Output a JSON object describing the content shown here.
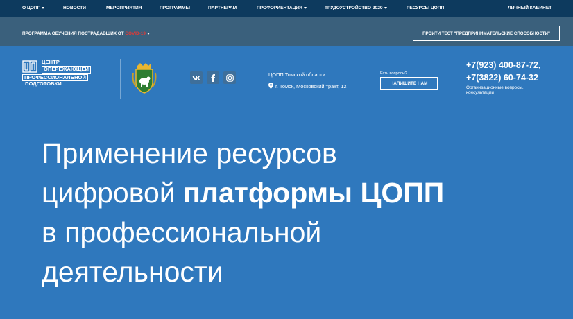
{
  "nav": {
    "items": [
      {
        "label": "О ЦОПП",
        "dropdown": true
      },
      {
        "label": "НОВОСТИ",
        "dropdown": false
      },
      {
        "label": "МЕРОПРИЯТИЯ",
        "dropdown": false
      },
      {
        "label": "ПРОГРАММЫ",
        "dropdown": false
      },
      {
        "label": "ПАРТНЕРАМ",
        "dropdown": false
      },
      {
        "label": "ПРОФОРИЕНТАЦИЯ",
        "dropdown": true
      },
      {
        "label": "ТРУДОУСТРОЙСТВО 2020",
        "dropdown": true
      },
      {
        "label": "РЕСУРСЫ ЦОПП",
        "dropdown": false
      },
      {
        "label": "ЛИЧНЫЙ КАБИНЕТ",
        "dropdown": false
      }
    ]
  },
  "subbar": {
    "program_label": "ПРОГРАММА ОБУЧЕНИЯ ПОСТРАДАВШИХ ОТ",
    "program_highlight": "COVID-19",
    "test_button": "ПРОЙТИ ТЕСТ \"ПРЕДПРИНИМАТЕЛЬСКИЕ СПОСОБНОСТИ\""
  },
  "logo": {
    "lines": [
      "ЦЕНТР",
      "ОПЕРЕЖАЮЩЕЙ",
      "ПРОФЕССИОНАЛЬНОЙ",
      "ПОДГОТОВКИ"
    ]
  },
  "social": {
    "vk": "vk-icon",
    "facebook": "facebook-icon",
    "instagram": "instagram-icon"
  },
  "contact": {
    "org_name": "ЦОПП Томской области",
    "address": "г. Томск, Московский тракт, 12",
    "questions": "Есть вопросы?",
    "write_button": "НАПИШИТЕ НАМ",
    "phone1": "+7(923) 400-87-72,",
    "phone2": "+7(3822) 60-74-32",
    "phone_note": "Организационные вопросы, консультации"
  },
  "hero": {
    "line1": "Применение ресурсов",
    "line2_normal": "цифровой ",
    "line2_bold": "платформы ЦОПП",
    "line3": "в профессиональной",
    "line4": "деятельности"
  },
  "colors": {
    "background": "#2f78bd",
    "topnav": "#0d3a5e",
    "subbar": "#3a607c",
    "accent_red": "#e53935"
  }
}
